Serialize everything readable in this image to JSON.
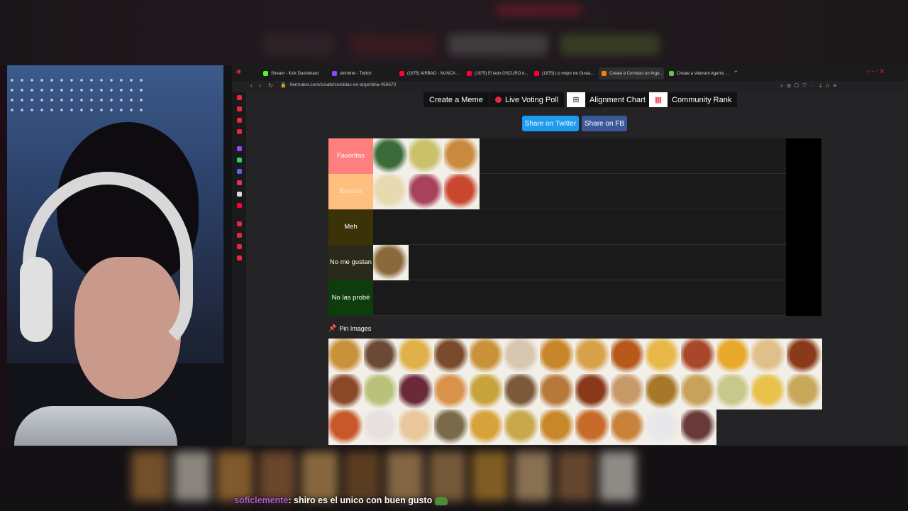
{
  "browser": {
    "tabs": [
      {
        "label": "Stream - Kick Dashboard",
        "color": "#53fc18"
      },
      {
        "label": "shirotnw - Twitch",
        "color": "#9146ff"
      },
      {
        "label": "(1875) AIRBAG - NUNCA ...",
        "color": "#ff0033"
      },
      {
        "label": "(1875) El lado OSCURO d...",
        "color": "#ff0033"
      },
      {
        "label": "(1875) Lo mejor de Gusta...",
        "color": "#ff0033"
      },
      {
        "label": "Create a Comidas en Arge...",
        "color": "#ff7f00"
      },
      {
        "label": "Create a Valorant Agents ...",
        "color": "#6cbf4c"
      }
    ],
    "url": "tiermaker.com/create/comidas-en-argentina-456670"
  },
  "toolbar": {
    "create_meme": "Create a Meme",
    "live_poll": "Live Voting Poll",
    "alignment_chart": "Alignment Chart",
    "community_rank": "Community Rank"
  },
  "share": {
    "twitter": "Share on Twitter",
    "facebook": "Share on FB"
  },
  "tiers": [
    {
      "label": "Favoritas",
      "color": "#ff7f7f",
      "label_color": "#ffffff",
      "items": [
        "sushi",
        "humitas",
        "empanadas"
      ]
    },
    {
      "label": "Buenas",
      "color": "#ffbf7f",
      "label_color": "#ffe9cf",
      "items": [
        "sandwich-de-miga",
        "picada",
        "pizza-fugazzeta"
      ]
    },
    {
      "label": "Meh",
      "color": "#3b3208",
      "label_color": "#ffffff",
      "items": []
    },
    {
      "label": "No me gustan",
      "color": "#2a2a1a",
      "label_color": "#ffffff",
      "items": [
        "pastel-de-papa"
      ]
    },
    {
      "label": "No las probé",
      "color": "#0d3d0d",
      "label_color": "#ffffff",
      "items": []
    }
  ],
  "pin_images": {
    "title": "Pin Images",
    "items": [
      "medialunas",
      "chocotorta",
      "bizcochuelo",
      "albondigas",
      "tarta",
      "alfajores",
      "churros",
      "canelones",
      "flan-con-dulce",
      "vigilante",
      "guiso",
      "papas-fritas",
      "pan-de-leche",
      "locro",
      "hamburguesa",
      "ensalada-rusa",
      "matambre",
      "rosquitas",
      "paella",
      "chorizo",
      "pollo",
      "albondigas-salsa",
      "pastelitos",
      "budin",
      "tortilla-papa",
      "noquis",
      "tortilla",
      "milanesa",
      "pancho",
      "helado",
      "pizza",
      "pascualina",
      "tacos",
      "sopa",
      "torta-rogel",
      "fideos",
      "waffle",
      "leche",
      "asado"
    ]
  },
  "chat": {
    "username": "soficlemente",
    "message": ": shiro es el unico con buen gusto"
  }
}
